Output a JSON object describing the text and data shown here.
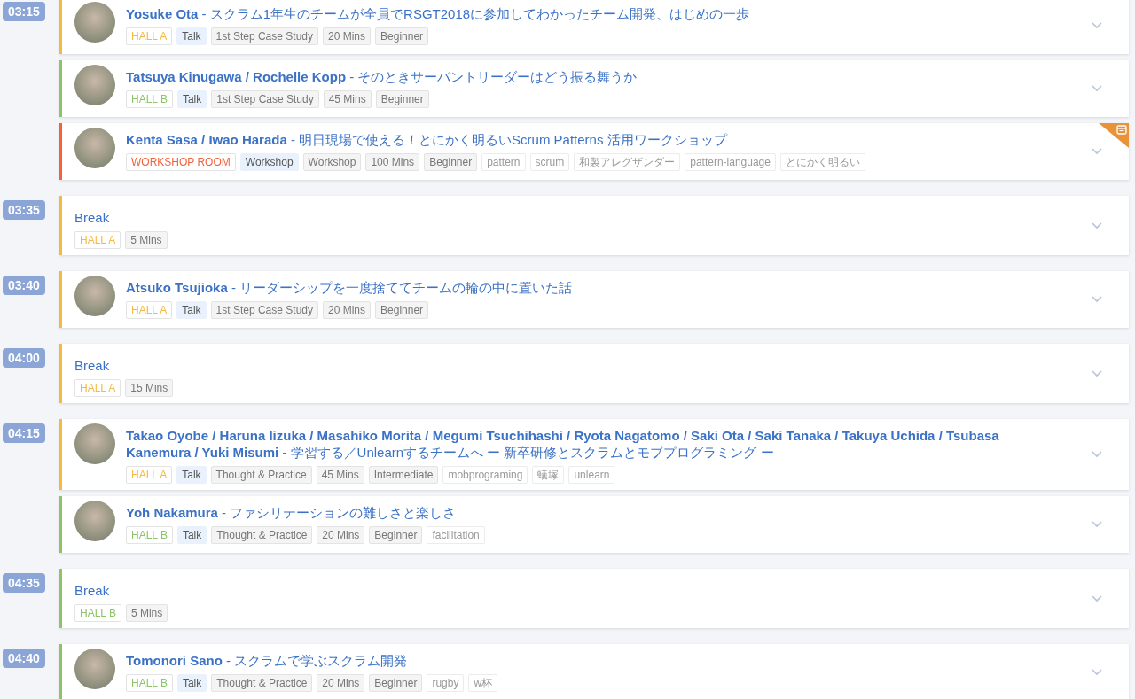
{
  "schedule": [
    {
      "time": "03:15",
      "sessions": [
        {
          "kind": "talk",
          "color": "#f5b942",
          "calendar_badge": false,
          "heading": "**Yosuke Ota** - スクラム1年生のチームが全員でRSGT2018に参加してわかったチーム開発、はじめの一歩",
          "tags": [
            {
              "kind": "room",
              "text": "HALL A"
            },
            {
              "kind": "type",
              "text": "Talk"
            },
            {
              "kind": "info",
              "text": "1st Step Case Study"
            },
            {
              "kind": "info",
              "text": "20 Mins"
            },
            {
              "kind": "info",
              "text": "Beginner"
            }
          ]
        },
        {
          "kind": "talk",
          "color": "#8cc466",
          "calendar_badge": false,
          "heading": "**Tatsuya Kinugawa / Rochelle Kopp** - そのときサーバントリーダーはどう振る舞うか",
          "tags": [
            {
              "kind": "room",
              "text": "HALL B"
            },
            {
              "kind": "type",
              "text": "Talk"
            },
            {
              "kind": "info",
              "text": "1st Step Case Study"
            },
            {
              "kind": "info",
              "text": "45 Mins"
            },
            {
              "kind": "info",
              "text": "Beginner"
            }
          ]
        },
        {
          "kind": "talk",
          "color": "#f0643c",
          "calendar_badge": true,
          "heading": "**Kenta Sasa / Iwao Harada** - 明日現場で使える！とにかく明るいScrum Patterns 活用ワークショップ",
          "tags": [
            {
              "kind": "room",
              "text": "WORKSHOP ROOM"
            },
            {
              "kind": "type",
              "text": "Workshop"
            },
            {
              "kind": "info",
              "text": "Workshop"
            },
            {
              "kind": "info",
              "text": "100 Mins"
            },
            {
              "kind": "info",
              "text": "Beginner"
            },
            {
              "kind": "keyword",
              "text": "pattern"
            },
            {
              "kind": "keyword",
              "text": "scrum"
            },
            {
              "kind": "keyword",
              "text": "和製アレグザンダー"
            },
            {
              "kind": "keyword",
              "text": "pattern-language"
            },
            {
              "kind": "keyword",
              "text": "とにかく明るい"
            }
          ]
        }
      ]
    },
    {
      "time": "03:35",
      "sessions": [
        {
          "kind": "break",
          "color": "#f5b942",
          "calendar_badge": false,
          "heading": "Break",
          "tags": [
            {
              "kind": "room",
              "text": "HALL A"
            },
            {
              "kind": "info",
              "text": "5 Mins"
            }
          ]
        }
      ]
    },
    {
      "time": "03:40",
      "sessions": [
        {
          "kind": "talk",
          "color": "#f5b942",
          "calendar_badge": false,
          "heading": "**Atsuko Tsujioka** - リーダーシップを一度捨ててチームの輪の中に置いた話",
          "tags": [
            {
              "kind": "room",
              "text": "HALL A"
            },
            {
              "kind": "type",
              "text": "Talk"
            },
            {
              "kind": "info",
              "text": "1st Step Case Study"
            },
            {
              "kind": "info",
              "text": "20 Mins"
            },
            {
              "kind": "info",
              "text": "Beginner"
            }
          ]
        }
      ]
    },
    {
      "time": "04:00",
      "sessions": [
        {
          "kind": "break",
          "color": "#f5b942",
          "calendar_badge": false,
          "heading": "Break",
          "tags": [
            {
              "kind": "room",
              "text": "HALL A"
            },
            {
              "kind": "info",
              "text": "15 Mins"
            }
          ]
        }
      ]
    },
    {
      "time": "04:15",
      "sessions": [
        {
          "kind": "talk",
          "color": "#f5b942",
          "calendar_badge": false,
          "heading": "**Takao Oyobe / Haruna Iizuka / Masahiko Morita / Megumi Tsuchihashi / Ryota Nagatomo / Saki Ota / Saki Tanaka / Takuya Uchida / Tsubasa Kanemura / Yuki Misumi** - 学習する／Unlearnするチームへ ー 新卒研修とスクラムとモブプログラミング ー",
          "tags": [
            {
              "kind": "room",
              "text": "HALL A"
            },
            {
              "kind": "type",
              "text": "Talk"
            },
            {
              "kind": "info",
              "text": "Thought & Practice"
            },
            {
              "kind": "info",
              "text": "45 Mins"
            },
            {
              "kind": "info",
              "text": "Intermediate"
            },
            {
              "kind": "keyword",
              "text": "mobprograming"
            },
            {
              "kind": "keyword",
              "text": "蟻塚"
            },
            {
              "kind": "keyword",
              "text": "unlearn"
            }
          ]
        },
        {
          "kind": "talk",
          "color": "#8cc466",
          "calendar_badge": false,
          "heading": "**Yoh Nakamura** - ファシリテーションの難しさと楽しさ",
          "tags": [
            {
              "kind": "room",
              "text": "HALL B"
            },
            {
              "kind": "type",
              "text": "Talk"
            },
            {
              "kind": "info",
              "text": "Thought & Practice"
            },
            {
              "kind": "info",
              "text": "20 Mins"
            },
            {
              "kind": "info",
              "text": "Beginner"
            },
            {
              "kind": "keyword",
              "text": "facilitation"
            }
          ]
        }
      ]
    },
    {
      "time": "04:35",
      "sessions": [
        {
          "kind": "break",
          "color": "#8cc466",
          "calendar_badge": false,
          "heading": "Break",
          "tags": [
            {
              "kind": "room",
              "text": "HALL B"
            },
            {
              "kind": "info",
              "text": "5 Mins"
            }
          ]
        }
      ]
    },
    {
      "time": "04:40",
      "sessions": [
        {
          "kind": "talk",
          "color": "#8cc466",
          "calendar_badge": false,
          "heading": "**Tomonori Sano** - スクラムで学ぶスクラム開発",
          "tags": [
            {
              "kind": "room",
              "text": "HALL B"
            },
            {
              "kind": "type",
              "text": "Talk"
            },
            {
              "kind": "info",
              "text": "Thought & Practice"
            },
            {
              "kind": "info",
              "text": "20 Mins"
            },
            {
              "kind": "info",
              "text": "Beginner"
            },
            {
              "kind": "keyword",
              "text": "rugby"
            },
            {
              "kind": "keyword",
              "text": "w杯"
            }
          ]
        }
      ]
    }
  ]
}
